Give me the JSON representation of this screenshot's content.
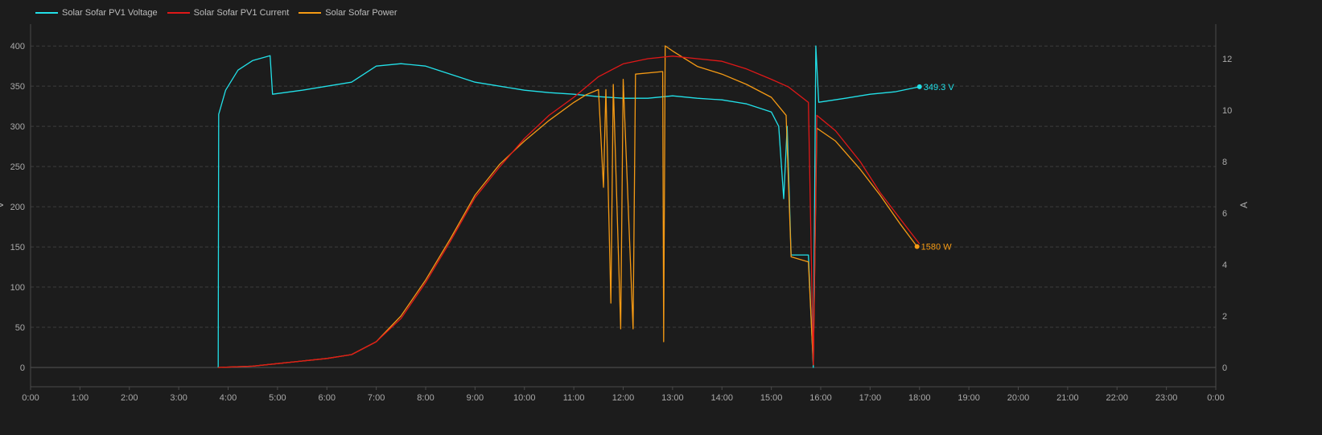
{
  "chart_data": {
    "type": "line",
    "left_axis": {
      "label": "V",
      "ticks": [
        0,
        50,
        100,
        150,
        200,
        250,
        300,
        350,
        400
      ],
      "range": [
        0,
        420
      ]
    },
    "right_axis": {
      "label": "A",
      "ticks": [
        0,
        2,
        4,
        6,
        8,
        10,
        12
      ],
      "range": [
        0,
        13.125
      ]
    },
    "x_axis": {
      "ticks": [
        "0:00",
        "1:00",
        "2:00",
        "3:00",
        "4:00",
        "5:00",
        "6:00",
        "7:00",
        "8:00",
        "9:00",
        "10:00",
        "11:00",
        "12:00",
        "13:00",
        "14:00",
        "15:00",
        "16:00",
        "17:00",
        "18:00",
        "19:00",
        "20:00",
        "21:00",
        "22:00",
        "23:00",
        "0:00"
      ],
      "range": [
        0,
        24
      ]
    },
    "grid": true,
    "legend_position": "top-left",
    "series": [
      {
        "name": "Solar Sofar PV1 Voltage",
        "axis": "left",
        "color": "#22e0e8",
        "end_label": "349.3 V",
        "points": [
          [
            3.8,
            0
          ],
          [
            3.81,
            315
          ],
          [
            3.95,
            345
          ],
          [
            4.2,
            370
          ],
          [
            4.5,
            382
          ],
          [
            4.85,
            388
          ],
          [
            4.9,
            340
          ],
          [
            5.5,
            345
          ],
          [
            6.0,
            350
          ],
          [
            6.5,
            355
          ],
          [
            7.0,
            375
          ],
          [
            7.5,
            378
          ],
          [
            8.0,
            375
          ],
          [
            8.5,
            365
          ],
          [
            9.0,
            355
          ],
          [
            9.5,
            350
          ],
          [
            10.0,
            345
          ],
          [
            10.5,
            342
          ],
          [
            11.0,
            340
          ],
          [
            11.5,
            337
          ],
          [
            12.0,
            335
          ],
          [
            12.5,
            335
          ],
          [
            13.0,
            338
          ],
          [
            13.5,
            335
          ],
          [
            14.0,
            333
          ],
          [
            14.5,
            328
          ],
          [
            15.0,
            318
          ],
          [
            15.15,
            300
          ],
          [
            15.25,
            210
          ],
          [
            15.32,
            300
          ],
          [
            15.4,
            140
          ],
          [
            15.75,
            140
          ],
          [
            15.85,
            0
          ],
          [
            15.9,
            400
          ],
          [
            15.96,
            330
          ],
          [
            16.5,
            335
          ],
          [
            17.0,
            340
          ],
          [
            17.5,
            343
          ],
          [
            18.0,
            349.3
          ]
        ]
      },
      {
        "name": "Solar Sofar PV1 Current",
        "axis": "right",
        "color": "#e01818",
        "points": [
          [
            3.8,
            0
          ],
          [
            4.5,
            0.05
          ],
          [
            5.0,
            0.15
          ],
          [
            5.5,
            0.25
          ],
          [
            6.0,
            0.35
          ],
          [
            6.5,
            0.5
          ],
          [
            7.0,
            1.0
          ],
          [
            7.5,
            1.9
          ],
          [
            8.0,
            3.3
          ],
          [
            8.5,
            4.9
          ],
          [
            9.0,
            6.6
          ],
          [
            9.5,
            7.8
          ],
          [
            10.0,
            8.9
          ],
          [
            10.5,
            9.8
          ],
          [
            11.0,
            10.5
          ],
          [
            11.5,
            11.3
          ],
          [
            12.0,
            11.8
          ],
          [
            12.5,
            12.0
          ],
          [
            13.0,
            12.1
          ],
          [
            13.5,
            12.0
          ],
          [
            14.0,
            11.9
          ],
          [
            14.5,
            11.6
          ],
          [
            15.0,
            11.2
          ],
          [
            15.35,
            10.9
          ],
          [
            15.75,
            10.3
          ],
          [
            15.85,
            0.1
          ],
          [
            15.92,
            9.8
          ],
          [
            16.3,
            9.2
          ],
          [
            16.8,
            8.0
          ],
          [
            17.2,
            6.8
          ],
          [
            17.6,
            5.8
          ],
          [
            18.0,
            4.8
          ]
        ]
      },
      {
        "name": "Solar Sofar Power",
        "axis": "right",
        "color": "#f59a14",
        "end_label": "1580 W",
        "points": [
          [
            3.8,
            0
          ],
          [
            4.5,
            0.05
          ],
          [
            5.0,
            0.15
          ],
          [
            5.5,
            0.25
          ],
          [
            6.0,
            0.35
          ],
          [
            6.5,
            0.5
          ],
          [
            7.0,
            1.0
          ],
          [
            7.5,
            2.0
          ],
          [
            8.0,
            3.4
          ],
          [
            8.5,
            5.0
          ],
          [
            9.0,
            6.7
          ],
          [
            9.5,
            7.9
          ],
          [
            10.0,
            8.8
          ],
          [
            10.5,
            9.6
          ],
          [
            11.0,
            10.3
          ],
          [
            11.25,
            10.6
          ],
          [
            11.5,
            10.8
          ],
          [
            11.6,
            7.0
          ],
          [
            11.65,
            10.8
          ],
          [
            11.75,
            2.5
          ],
          [
            11.8,
            11.0
          ],
          [
            11.95,
            1.5
          ],
          [
            12.0,
            11.2
          ],
          [
            12.2,
            1.5
          ],
          [
            12.25,
            11.4
          ],
          [
            12.8,
            11.5
          ],
          [
            12.82,
            1.0
          ],
          [
            12.85,
            12.5
          ],
          [
            13.0,
            12.3
          ],
          [
            13.5,
            11.7
          ],
          [
            14.0,
            11.4
          ],
          [
            14.5,
            11.0
          ],
          [
            15.0,
            10.5
          ],
          [
            15.3,
            9.8
          ],
          [
            15.4,
            4.3
          ],
          [
            15.75,
            4.1
          ],
          [
            15.85,
            0.1
          ],
          [
            15.92,
            9.3
          ],
          [
            16.3,
            8.8
          ],
          [
            16.8,
            7.7
          ],
          [
            17.2,
            6.7
          ],
          [
            17.6,
            5.6
          ],
          [
            17.95,
            4.7
          ]
        ]
      }
    ]
  }
}
